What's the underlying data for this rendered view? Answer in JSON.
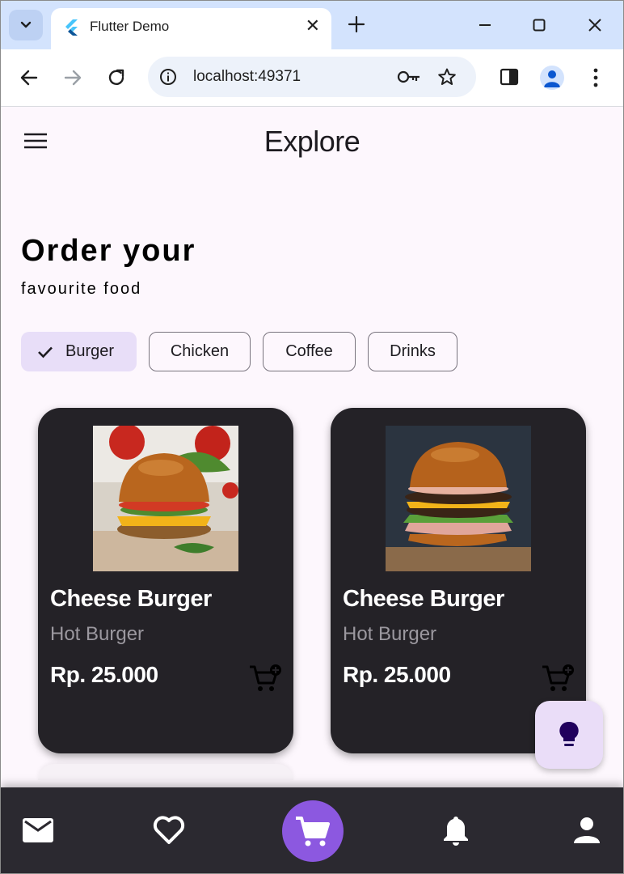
{
  "browser": {
    "tab_title": "Flutter Demo",
    "tab_close": "✕",
    "url": "localhost:49371",
    "icons": [
      "chevron-down-icon",
      "flutter-logo-icon",
      "close-icon",
      "plus-icon",
      "minimize-icon",
      "maximize-icon",
      "close-window-icon",
      "back-arrow-icon",
      "forward-arrow-icon",
      "reload-icon",
      "info-icon",
      "key-icon",
      "star-icon",
      "side-panel-icon",
      "profile-icon",
      "more-vert-icon"
    ]
  },
  "app": {
    "title": "Explore",
    "headline": "Order your",
    "subheadline": "favourite food",
    "chips": [
      {
        "label": "Burger",
        "selected": true
      },
      {
        "label": "Chicken",
        "selected": false
      },
      {
        "label": "Coffee",
        "selected": false
      },
      {
        "label": "Drinks",
        "selected": false
      }
    ],
    "products": [
      {
        "name": "Cheese Burger",
        "category": "Hot Burger",
        "price": "Rp. 25.000"
      },
      {
        "name": "Cheese Burger",
        "category": "Hot Burger",
        "price": "Rp. 25.000"
      }
    ],
    "fab_icon": "lightbulb-icon",
    "bottom_nav": [
      "mail-icon",
      "heart-icon",
      "cart-icon",
      "bell-icon",
      "person-icon"
    ],
    "colors": {
      "accent": "#8c58e0",
      "chip_selected": "#e8def8",
      "card": "#242227",
      "nav": "#2b2930"
    }
  }
}
